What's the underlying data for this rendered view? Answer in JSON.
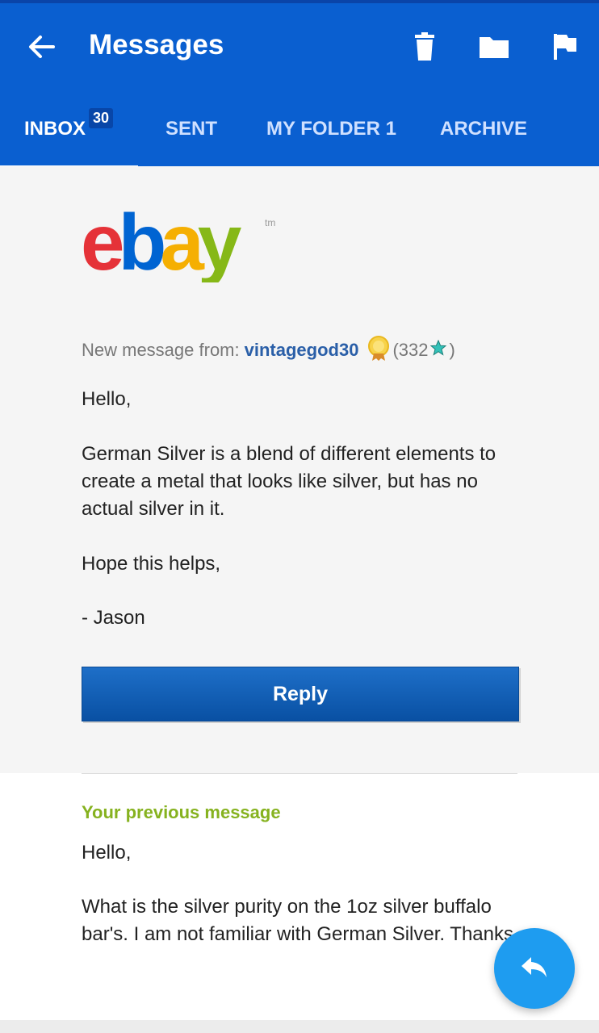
{
  "header": {
    "title": "Messages"
  },
  "tabs": [
    {
      "label": "INBOX",
      "badge": "30"
    },
    {
      "label": "SENT"
    },
    {
      "label": "MY FOLDER 1"
    },
    {
      "label": "ARCHIVE"
    }
  ],
  "message": {
    "logo_text": "ebay",
    "logo_tm": "tm",
    "from_label": "New message from:",
    "sender": "vintagegod30",
    "rating_open": "(332",
    "rating_close": ")",
    "greeting": "Hello,",
    "paragraph": "German Silver is a blend of different elements to create a metal that looks like silver, but has no actual silver in it.",
    "closing": "Hope this helps,",
    "signature": "- Jason",
    "reply_label": "Reply"
  },
  "previous": {
    "heading": "Your previous message",
    "greeting": "Hello,",
    "body": "What is the silver purity on the 1oz silver buffalo bar's. I am not familiar with German Silver. Thanks"
  },
  "colors": {
    "appbar": "#0a5fd0",
    "accent_green": "#86b21f",
    "fab": "#1e9cf0"
  },
  "icons": {
    "back": "arrow-left-icon",
    "delete": "trash-icon",
    "move": "folder-icon",
    "flag": "flag-icon",
    "fab": "reply-icon"
  }
}
